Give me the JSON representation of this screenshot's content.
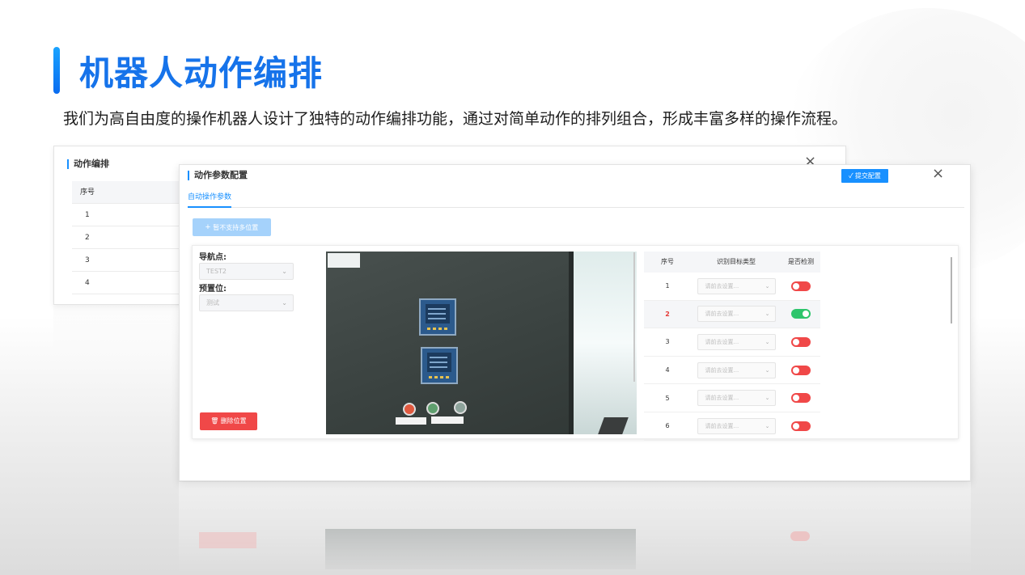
{
  "page": {
    "title": "机器人动作编排",
    "subtitle": "我们为高自由度的操作机器人设计了独特的动作编排功能，通过对简单动作的排列组合，形成丰富多样的操作流程。"
  },
  "back_panel": {
    "title": "动作编排",
    "close": "×",
    "table": {
      "header": "序号",
      "rows": [
        "1",
        "2",
        "3",
        "4"
      ]
    }
  },
  "dialog": {
    "title": "动作参数配置",
    "submit_label": "✓ 提交配置",
    "close": "×",
    "tab_label": "自动操作参数",
    "add_button_label": "暂不支持多位置",
    "nav_point": {
      "label": "导航点:",
      "value": "TEST2"
    },
    "preset": {
      "label": "预置位:",
      "value": "测试"
    },
    "delete_button_label": "删除位置",
    "table": {
      "headers": {
        "index": "序号",
        "target_type": "识别目标类型",
        "detect": "是否检测"
      },
      "select_placeholder": "请前去设置...",
      "rows": [
        {
          "index": "1",
          "detect": false
        },
        {
          "index": "2",
          "detect": true
        },
        {
          "index": "3",
          "detect": false
        },
        {
          "index": "4",
          "detect": false
        },
        {
          "index": "5",
          "detect": false
        },
        {
          "index": "6",
          "detect": false
        }
      ]
    }
  },
  "colors": {
    "brand": "#1673ea",
    "primary": "#1890ff",
    "danger": "#f04848",
    "success": "#2ec56c"
  }
}
